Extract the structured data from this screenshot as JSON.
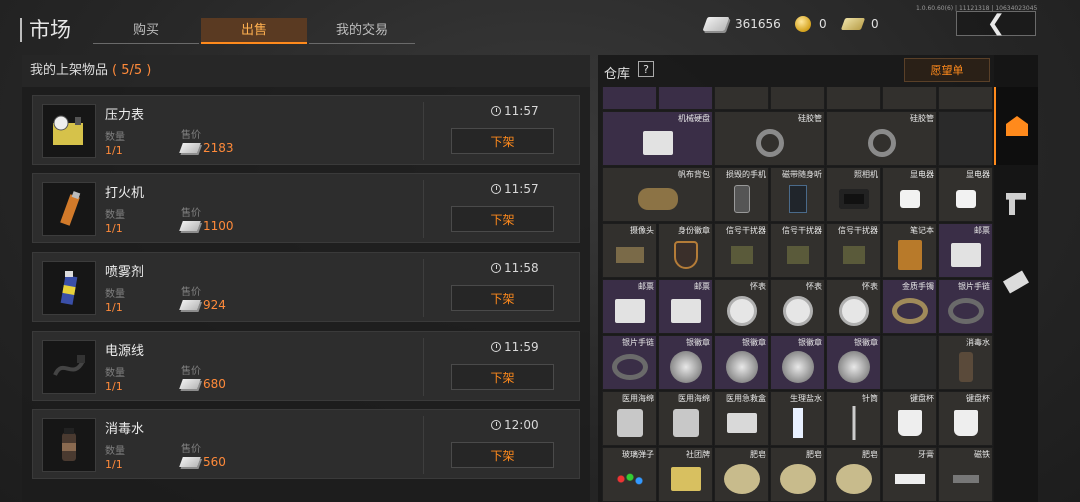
{
  "header": {
    "title": "市场",
    "tabs": {
      "buy": "购买",
      "sell": "出售",
      "my_trades": "我的交易"
    },
    "version": "1.0.60.60(6) | 11121318 | 10634023045"
  },
  "currency": {
    "money": "361656",
    "coins": "0",
    "tickets": "0"
  },
  "listings": {
    "heading": "我的上架物品",
    "count": "( 5/5 )",
    "qty_label": "数量",
    "price_label": "售价",
    "delist_label": "下架",
    "items": [
      {
        "name": "压力表",
        "qty": "1/1",
        "price": "2183",
        "time": "11:57",
        "icon": "pressure-gauge-icon"
      },
      {
        "name": "打火机",
        "qty": "1/1",
        "price": "1100",
        "time": "11:57",
        "icon": "lighter-icon"
      },
      {
        "name": "喷雾剂",
        "qty": "1/1",
        "price": "924",
        "time": "11:58",
        "icon": "spray-icon"
      },
      {
        "name": "电源线",
        "qty": "1/1",
        "price": "680",
        "time": "11:59",
        "icon": "power-cord-icon"
      },
      {
        "name": "消毒水",
        "qty": "1/1",
        "price": "560",
        "time": "12:00",
        "icon": "disinfectant-icon"
      }
    ]
  },
  "warehouse": {
    "title": "仓库",
    "help": "?",
    "wishlist": "愿望单",
    "cells": [
      [
        "机械硬盘",
        "硅胶管",
        "硅胶管",
        ""
      ],
      [
        "帆布背包",
        "损毁的手机",
        "磁带随身听",
        "照相机",
        "显电器",
        "显电器"
      ],
      [
        "摄像头",
        "身份徽章",
        "信号干扰器",
        "信号干扰器",
        "信号干扰器",
        "笔记本",
        "邮票"
      ],
      [
        "邮票",
        "邮票",
        "怀表",
        "怀表",
        "怀表",
        "金质手镯",
        "银片手链"
      ],
      [
        "银片手链",
        "银徽章",
        "银徽章",
        "银徽章",
        "银徽章",
        "",
        "消毒水"
      ],
      [
        "医用海绵",
        "医用海绵",
        "医用急救盒",
        "生理盐水",
        "针筒",
        "键盘杯",
        "键盘杯"
      ],
      [
        "玻璃弹子",
        "社团牌",
        "肥皂",
        "肥皂",
        "肥皂",
        "牙膏",
        "磁铁"
      ]
    ]
  },
  "side_nav": [
    "home-icon",
    "pistol-icon",
    "cash-icon"
  ],
  "colors": {
    "accent": "#ff8a1c",
    "price": "#ff8a3a",
    "purple_rarity": "#3a2e47"
  }
}
